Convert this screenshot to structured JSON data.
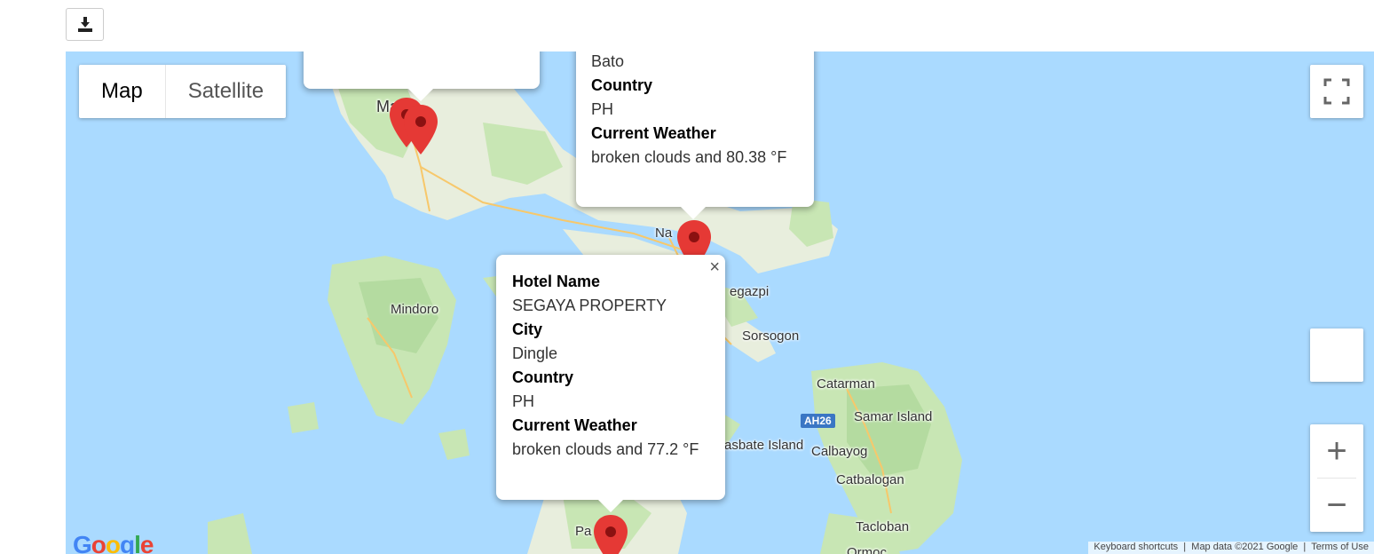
{
  "download_icon": "download-icon",
  "map": {
    "type_control": {
      "map_label": "Map",
      "satellite_label": "Satellite"
    },
    "zoom_in": "+",
    "zoom_out": "−",
    "places": {
      "manila": "Ma  la",
      "naga": "Na",
      "legazpi": "egazpi",
      "sorsogon": "Sorsogon",
      "mindoro": "Mindoro",
      "catarman": "Catarman",
      "samar": "Samar Island",
      "masbate": "asbate Island",
      "calbayog": "Calbayog",
      "catbalogan": "Catbalogan",
      "tacloban": "Tacloban",
      "ormoc": "Ormoc",
      "pa": "Pa"
    },
    "shield": "AH26",
    "attribution": {
      "shortcuts": "Keyboard shortcuts",
      "data": "Map data ©2021 Google",
      "terms": "Terms of Use"
    },
    "logo": "Google"
  },
  "popup_top": {
    "city_value": "Bato",
    "country_label": "Country",
    "country_value": "PH",
    "weather_label": "Current Weather",
    "weather_value": "broken clouds and 80.38 °F"
  },
  "popup_main": {
    "hotel_label": "Hotel Name",
    "hotel_value": "SEGAYA PROPERTY",
    "city_label": "City",
    "city_value": "Dingle",
    "country_label": "Country",
    "country_value": "PH",
    "weather_label": "Current Weather",
    "weather_value": "broken clouds and 77.2 °F"
  },
  "colors": {
    "water": "#aadaff",
    "land": "#e8eedd",
    "green": "#c8e6b4",
    "road": "#f7c86b",
    "pin": "#e53935"
  }
}
